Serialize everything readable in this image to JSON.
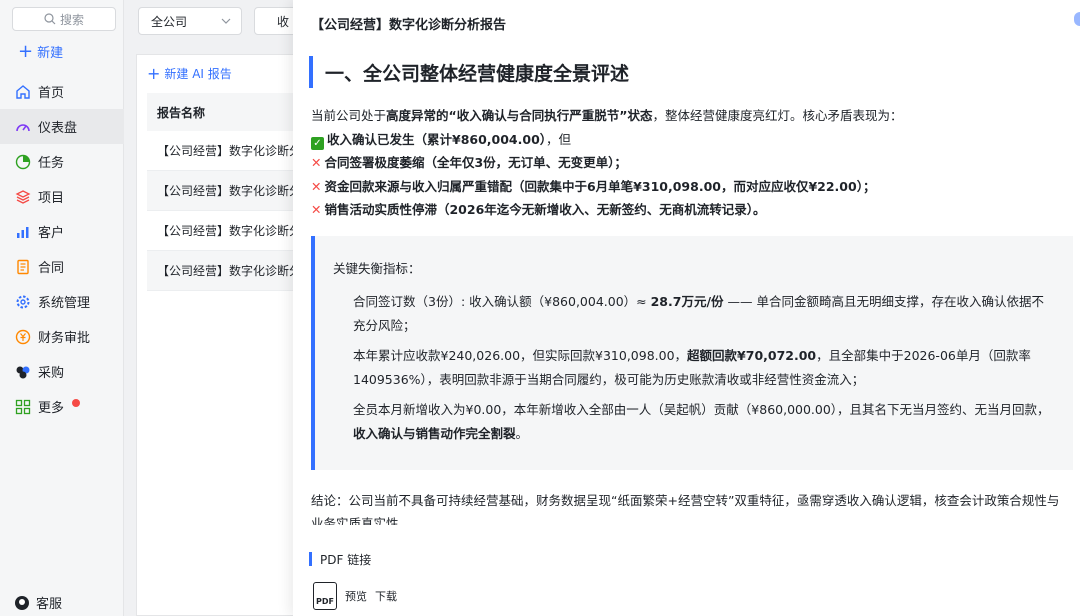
{
  "sidebar": {
    "search_label": "搜索",
    "new_label": "新建",
    "items": [
      {
        "label": "首页",
        "icon": "home-icon",
        "color": "#3370ff"
      },
      {
        "label": "仪表盘",
        "icon": "dashboard-icon",
        "color": "#7f3bf5"
      },
      {
        "label": "任务",
        "icon": "task-icon",
        "color": "#2ea121"
      },
      {
        "label": "项目",
        "icon": "project-icon",
        "color": "#f54a45"
      },
      {
        "label": "客户",
        "icon": "customer-icon",
        "color": "#3370ff"
      },
      {
        "label": "合同",
        "icon": "contract-icon",
        "color": "#ff8800"
      },
      {
        "label": "系统管理",
        "icon": "settings-icon",
        "color": "#3370ff"
      },
      {
        "label": "财务审批",
        "icon": "finance-icon",
        "color": "#ff8800"
      },
      {
        "label": "采购",
        "icon": "purchase-icon",
        "color": "#1f2329"
      },
      {
        "label": "更多",
        "icon": "more-icon",
        "color": "#2ea121"
      }
    ],
    "service_label": "客服"
  },
  "filters": {
    "company": "全公司",
    "second": "收"
  },
  "list": {
    "new_report": "新建 AI 报告",
    "header": "报告名称",
    "rows": [
      "【公司经营】数字化诊断分析报告",
      "【公司经营】数字化诊断分析报告",
      "【公司经营】数字化诊断分析报告",
      "【公司经营】数字化诊断分析报告"
    ]
  },
  "report": {
    "title": "【公司经营】数字化诊断分析报告",
    "h1": "一、全公司整体经营健康度全景评述",
    "intro_pre": "当前公司处于",
    "intro_bold": "高度异常的“收入确认与合同执行严重脱节”状态",
    "intro_post": "，整体经营健康度亮红灯。核心矛盾表现为：",
    "bullet1_bold": "收入确认已发生（累计¥860,004.00）",
    "bullet1_post": "，但",
    "bullet2": "合同签署极度萎缩（全年仅3份，无订单、无变更单）；",
    "bullet3": "资金回款来源与收入归属严重错配（回款集中于6月单笔¥310,098.00，而对应应收仅¥22.00）；",
    "bullet4": "销售活动实质性停滞（2026年迄今无新增收入、无新签约、无商机流转记录）。",
    "quote_title": "关键失衡指标：",
    "q1_pre": "合同签订数（3份）: 收入确认额（¥860,004.00）≈ ",
    "q1_bold": "28.7万元/份",
    "q1_post": " —— 单合同金额畸高且无明细支撑，存在收入确认依据不充分风险；",
    "q2_pre": "本年累计应收款¥240,026.00，但实际回款¥310,098.00，",
    "q2_bold": "超额回款¥70,072.00",
    "q2_post": "，且全部集中于2026-06单月（回款率1409536%），表明回款非源于当期合同履约，极可能为历史账款清收或非经营性资金流入；",
    "q3_pre": "全员本月新增收入为¥0.00，本年新增收入全部由一人（吴起帆）贡献（¥860,000.00），且其名下无当月签约、无当月回款，",
    "q3_bold": "收入确认与销售动作完全割裂",
    "q3_post": "。",
    "conclusion": "结论：公司当前不具备可持续经营基础，财务数据呈现“纸面繁荣+经营空转”双重特征，亟需穿透收入确认逻辑，核查会计政策合规性与业务实质真实性。",
    "pdf_title": "PDF 链接",
    "pdf_icon_text": "PDF",
    "pdf_preview": "预览",
    "pdf_download": "下载"
  },
  "colors": {
    "accent": "#3370ff",
    "danger": "#f54a45",
    "success": "#2ea121"
  }
}
